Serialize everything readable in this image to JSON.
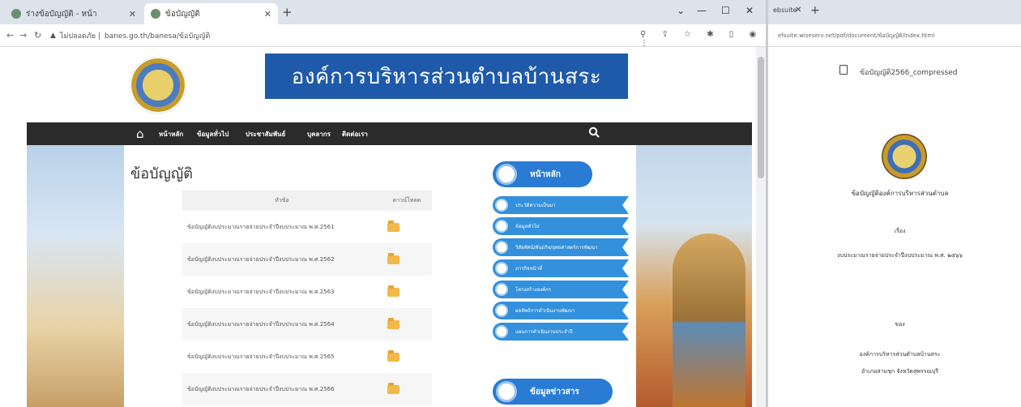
{
  "browser": {
    "tabs": [
      {
        "title": "ร่างข้อบัญญัติ - หน้า",
        "active": false
      },
      {
        "title": "ข้อบัญญัติ",
        "active": true
      }
    ],
    "url": "banes.go.th/banesa/ข้อบัญญัติ",
    "url_prefix": "ไม่ปลอดภัย |"
  },
  "site": {
    "banner_title": "องค์การบริหารส่วนตำบลบ้านสระ",
    "nav": [
      "หน้าหลัก",
      "ข้อมูลทั่วไป",
      "ประชาสัมพันธ์",
      "บุคลากร",
      "ติดต่อเรา"
    ],
    "page_title": "ข้อบัญญัติ",
    "table": {
      "headers": {
        "name": "หัวข้อ",
        "download": "ดาวน์โหลด"
      },
      "rows": [
        "ข้อบัญญัติงบประมาณรายจ่ายประจำปีงบประมาณ พ.ศ.2561",
        "ข้อบัญญัติงบประมาณรายจ่ายประจำปีงบประมาณ พ.ศ.2562",
        "ข้อบัญญัติงบประมาณรายจ่ายประจำปีงบประมาณ พ.ศ.2563",
        "ข้อบัญญัติงบประมาณรายจ่ายประจำปีงบประมาณ พ.ศ.2564",
        "ข้อบัญญัติงบประมาณรายจ่ายประจำปีงบประมาณ พ.ศ.2565",
        "ข้อบัญญัติงบประมาณรายจ่ายประจำปีงบประมาณ พ.ศ.2566"
      ]
    },
    "sidebar": {
      "main": "หน้าหลัก",
      "items": [
        "ประวัติความเป็นมา",
        "ข้อมูลทั่วไป",
        "วิสัยทัศน์/พันธกิจ/ยุทธศาสตร์การพัฒนา",
        "ภารกิจหน้าที่",
        "โครงสร้างองค์กร",
        "ผลลัพธ์การดำเนินงานพัฒนา",
        "แผนการดำเนินงานประจำปี"
      ],
      "sub": "ข้อมูลข่าวสาร"
    }
  },
  "pdf": {
    "tab": "ebsuite",
    "url": "efsuite.wiseserv.net/pdf/document/ข้อบัญญัติ/index.html",
    "filename": "ข้อบัญญัติ2566_compressed",
    "lines": [
      "ข้อบัญญัติองค์การบริหารส่วนตำบล",
      "เรื่อง",
      "งบประมาณรายจ่ายประจำปีงบประมาณ พ.ศ. ๒๕๖๖",
      "ของ",
      "องค์การบริหารส่วนตำบลบ้านสระ",
      "อำเภอสามชุก จังหวัดสุพรรณบุรี"
    ]
  }
}
